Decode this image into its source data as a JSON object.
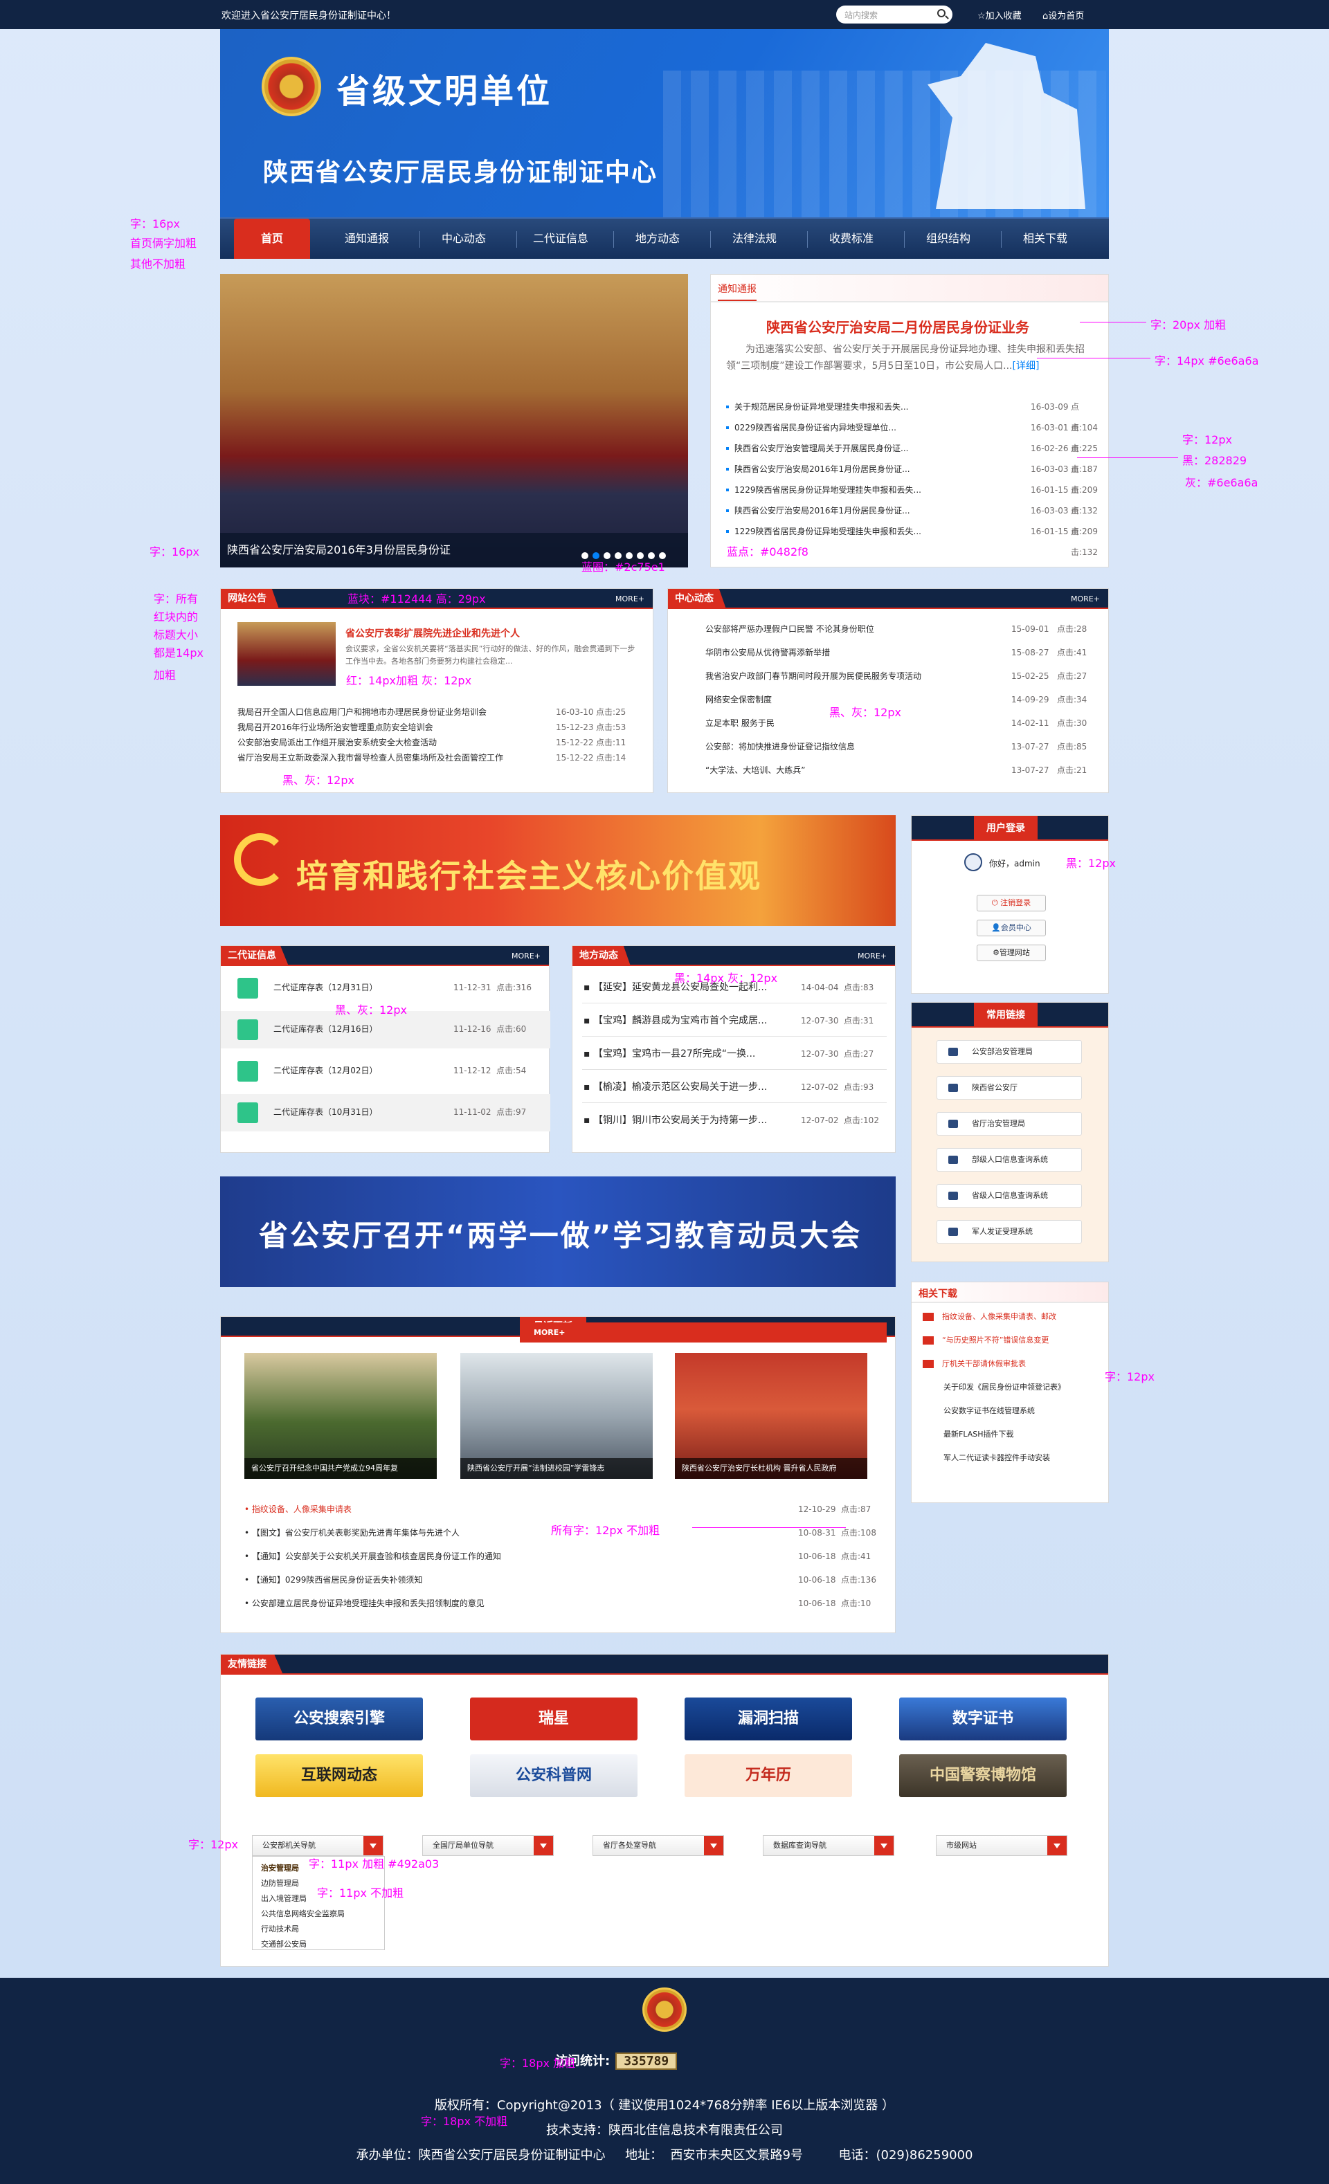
{
  "topbar": {
    "welcome": "欢迎进入省公安厅居民身份证制证中心！",
    "search_placeholder": "站内搜索",
    "fav": "加入收藏",
    "home": "设为首页"
  },
  "banner": {
    "title": "省级文明单位",
    "subtitle": "陕西省公安厅居民身份证制证中心"
  },
  "nav": [
    "首页",
    "通知通报",
    "中心动态",
    "二代证信息",
    "地方动态",
    "法律法规",
    "收费标准",
    "组织结构",
    "相关下载"
  ],
  "photo": {
    "caption": "陕西省公安厅治安局2016年3月份居民身份证",
    "dots": 8,
    "active_dot": 1
  },
  "notice": {
    "tab": "通知通报",
    "headline": "陕西省公安厅治安局二月份居民身份证业务",
    "summary": "为迅速落实公安部、省公安厅关于开展居民身份证异地办理、挂失申报和丢失招领“三项制度”建设工作部署要求，5月5日至10日，市公安局人口...",
    "more": "[详细]",
    "items": [
      [
        "关于规范居民身份证异地受理挂失申报和丢失...",
        "16-03-09",
        "点击:104"
      ],
      [
        "0229陕西省居民身份证省内异地受理单位...",
        "16-03-01",
        "点击:225"
      ],
      [
        "陕西省公安厅治安管理局关于开展居民身份证...",
        "16-02-26",
        "点击:187"
      ],
      [
        "陕西省公安厅治安局2016年1月份居民身份证...",
        "16-03-03",
        "点击:209"
      ],
      [
        "1229陕西省居民身份证异地受理挂失申报和丢失...",
        "16-01-15",
        "点击:132"
      ],
      [
        "陕西省公安厅治安局2016年1月份居民身份证...",
        "16-03-03",
        "点击:209"
      ],
      [
        "1229陕西省居民身份证异地受理挂失申报和丢失...",
        "16-01-15",
        "点击:132"
      ]
    ]
  },
  "announce": {
    "title": "网站公告",
    "more": "MORE+",
    "feature_title": "省公安厅表彰扩展院先进企业和先进个人",
    "feature_text": "会议要求，全省公安机关要将“落基实民”行动好的做法、好的作风，融会贯通到下一步工作当中去。各地各部门务要努力构建社会稳定...",
    "items": [
      [
        "我局召开全国人口信息应用门户和拥地市办理居民身份证业务培训会",
        "16-03-10",
        "点击:25"
      ],
      [
        "我局召开2016年行业场所治安管理重点防安全培训会",
        "15-12-23",
        "点击:53"
      ],
      [
        "公安部治安局派出工作组开展治安系统安全大检查活动",
        "15-12-22",
        "点击:11"
      ],
      [
        "省厅治安局王立新政委深入我市督导检查人员密集场所及社会面管控工作",
        "15-12-22",
        "点击:14"
      ]
    ]
  },
  "center": {
    "title": "中心动态",
    "more": "MORE+",
    "items": [
      [
        "公安部将严惩办理假户口民警 不论其身份职位",
        "15-09-01",
        "点击:28"
      ],
      [
        "华阴市公安局从优待警再添新举措",
        "15-08-27",
        "点击:41"
      ],
      [
        "我省治安户政部门春节期间时段开展为民便民服务专项活动",
        "15-02-25",
        "点击:27"
      ],
      [
        "网络安全保密制度",
        "14-09-29",
        "点击:34"
      ],
      [
        "立足本职 服务于民",
        "14-02-11",
        "点击:30"
      ],
      [
        "公安部：将加快推进身份证登记指纹信息",
        "13-07-27",
        "点击:85"
      ],
      [
        "“大学法、大培训、大练兵”",
        "13-07-27",
        "点击:21"
      ]
    ]
  },
  "banner2": "培育和践行社会主义核心价值观",
  "login": {
    "title": "用户登录",
    "greeting": "你好，admin",
    "buttons": [
      "注销登录",
      "会员中心",
      "管理网站"
    ]
  },
  "links": {
    "title": "常用链接",
    "items": [
      "公安部治安管理局",
      "陕西省公安厅",
      "省厅治安管理局",
      "部级人口信息查询系统",
      "省级人口信息查询系统",
      "军人发证受理系统"
    ]
  },
  "idinfo": {
    "title": "二代证信息",
    "more": "MORE+",
    "items": [
      [
        "二代证库存表（12月31日）",
        "11-12-31",
        "点击:316"
      ],
      [
        "二代证库存表（12月16日）",
        "11-12-16",
        "点击:60"
      ],
      [
        "二代证库存表（12月02日）",
        "11-12-12",
        "点击:54"
      ],
      [
        "二代证库存表（10月31日）",
        "11-11-02",
        "点击:97"
      ]
    ]
  },
  "local": {
    "title": "地方动态",
    "more": "MORE+",
    "items": [
      [
        "【延安】延安黄龙县公安局查处一起利...",
        "14-04-04",
        "点击:83"
      ],
      [
        "【宝鸡】麟游县成为宝鸡市首个完成居...",
        "12-07-30",
        "点击:31"
      ],
      [
        "【宝鸡】宝鸡市一县27所完成“一换...",
        "12-07-30",
        "点击:27"
      ],
      [
        "【榆凌】榆凌示范区公安局关于进一步...",
        "12-07-02",
        "点击:93"
      ],
      [
        "【铜川】铜川市公安局关于为持第一步...",
        "12-07-02",
        "点击:102"
      ]
    ]
  },
  "banner3": "省公安厅召开“两学一做”学习教育动员大会",
  "download": {
    "title": "相关下载",
    "items": [
      "指纹设备、人像采集申请表、邮改",
      "“与历史照片不符”错误信息变更",
      "厅机关干部请休假审批表",
      "关于印发《居民身份证申领登记表》",
      "公安数字证书在线管理系统",
      "最新FLASH插件下载",
      "军人二代证读卡器控件手动安装"
    ]
  },
  "recent": {
    "title": "最近更新",
    "more": "MORE+",
    "thumbs": [
      "省公安厅召开纪念中国共产党成立94周年复",
      "陕西省公安厅开展“法制进校园”学雷锋志",
      "陕西省公安厅治安厅长杜机构 晋升省人民政府"
    ],
    "items": [
      [
        "指纹设备、人像采集申请表",
        "12-10-29",
        "点击:87"
      ],
      [
        "【图文】省公安厅机关表彰奖励先进青年集体与先进个人",
        "10-08-31",
        "点击:108"
      ],
      [
        "【通知】公安部关于公安机关开展查验和核查居民身份证工作的通知",
        "10-06-18",
        "点击:41"
      ],
      [
        "【通知】0299陕西省居民身份证丢失补领须知",
        "10-06-18",
        "点击:136"
      ],
      [
        "公安部建立居民身份证异地受理挂失申报和丢失招领制度的意见",
        "10-06-18",
        "点击:10"
      ]
    ]
  },
  "friends": {
    "title": "友情链接",
    "logos": [
      "公安搜索引擎",
      "瑞星",
      "漏洞扫描",
      "数字证书",
      "互联网动态",
      "公安科普网",
      "万年历",
      "中国警察博物馆"
    ],
    "selects": [
      "公安部机关导航",
      "全国厅局单位导航",
      "省厅各处室导航",
      "数据库查询导航",
      "市级网站"
    ],
    "dropdown": [
      "治安管理局",
      "边防管理局",
      "出入境管理局",
      "公共信息网络安全监察局",
      "行动技术局",
      "交通部公安局"
    ]
  },
  "footer": {
    "counter_label": "访问统计:",
    "counter": "335789",
    "copyright": "版权所有：Copyright@2013（ 建议使用1024*768分辨率  IE6以上版本浏览器 ）",
    "tech": "技术支持：陕西北佳信息技术有限责任公司",
    "host": "承办单位：陕西省公安厅居民身份证制证中心     地址：  西安市未央区文景路9号         电话：(029)86259000"
  },
  "annotations": [
    "字：16px",
    "首页俩字加粗",
    "其他不加粗",
    "字：20px 加粗",
    "字：14px #6e6a6a",
    "字：12px",
    "黑：282829",
    "灰：#6e6a6a",
    "字：16px",
    "蓝圈：#2c75e1",
    "蓝点：#0482f8",
    "字：所有",
    "红块内的",
    "标题大小",
    "都是14px",
    "加粗",
    "蓝块：#112444 高：29px",
    "红：14px加粗    灰：12px",
    "黑、灰：12px",
    "黑、灰：12px",
    "黑：12px",
    "黑、灰：12px",
    "黑：14px   灰：12px",
    "字：12px",
    "所有字：12px 不加粗",
    "字：12px",
    "字：11px 加粗  #492a03",
    "字：11px 不加粗",
    "字：18px  加粗",
    "字：18px  不加粗"
  ],
  "colors": {
    "navy": "#112444",
    "red": "#d92d1e",
    "blue_dot": "#0482f8",
    "gray": "#6e6a6a",
    "black": "#282829"
  }
}
